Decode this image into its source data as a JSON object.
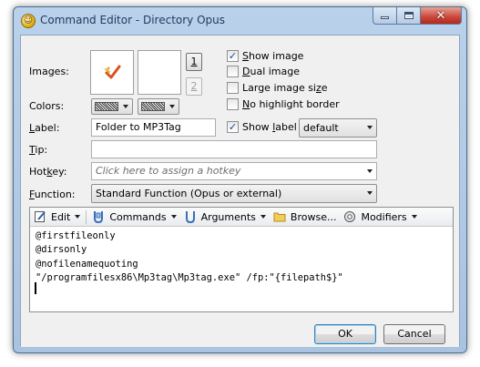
{
  "window": {
    "title": "Command Editor - Directory Opus"
  },
  "labels": {
    "images": "Images:",
    "colors": "Colors:",
    "label_pre": "",
    "label_u": "L",
    "label_post": "abel:",
    "tip_u": "T",
    "tip_post": "ip:",
    "hotkey_pre": "Hot",
    "hotkey_u": "k",
    "hotkey_post": "ey:",
    "function_u": "F",
    "function_post": "unction:"
  },
  "image_buttons": {
    "one": "1",
    "two": "2"
  },
  "options": {
    "show_image": {
      "u": "S",
      "rest": "how image",
      "checked": true
    },
    "dual_image": {
      "u": "D",
      "rest": "ual image",
      "checked": false
    },
    "large_image_pre": "Large image si",
    "large_image_u": "z",
    "large_image_post": "e",
    "large_image_checked": false,
    "no_highlight": {
      "u": "N",
      "rest": "o highlight border",
      "checked": false
    },
    "show_label_pre": "Show ",
    "show_label_u": "l",
    "show_label_post": "abel",
    "show_label_checked": true
  },
  "fields": {
    "label_value": "Folder to MP3Tag",
    "tip_value": "",
    "hotkey_placeholder": "Click here to assign a hotkey",
    "label_mode": "default",
    "function_value": "Standard Function (Opus or external)"
  },
  "toolbar": {
    "edit": "Edit",
    "commands": "Commands",
    "arguments": "Arguments",
    "browse": "Browse...",
    "modifiers": "Modifiers"
  },
  "code_lines": [
    "@firstfileonly",
    "@dirsonly",
    "@nofilenamequoting",
    "\"/programfilesx86\\Mp3tag\\Mp3tag.exe\" /fp:\"{filepath$}\""
  ],
  "buttons": {
    "ok": "OK",
    "cancel": "Cancel"
  },
  "colors": {
    "title_bar": "#b9d1ea",
    "client": "#f0f0f0",
    "check": "#21459a"
  }
}
